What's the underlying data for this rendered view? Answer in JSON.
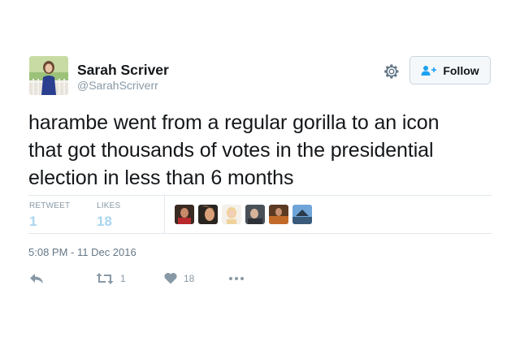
{
  "user": {
    "name": "Sarah Scriver",
    "handle": "@SarahScriverr"
  },
  "follow_label": "Follow",
  "tweet": {
    "line1": "harambe went from a regular gorilla to an icon",
    "line2": "that got thousands of votes in the presidential",
    "line3": "election in less than 6 months"
  },
  "stats": {
    "retweet_label": "RETWEET",
    "retweet_count": "1",
    "likes_label": "LIKES",
    "likes_count": "18"
  },
  "timestamp": "5:08 PM - 11 Dec 2016",
  "actions": {
    "retweet_count": "1",
    "like_count": "18"
  },
  "colors": {
    "stat_value": "#a8d6f0",
    "muted": "#8899a6",
    "follow_icon": "#1da1f2"
  },
  "icons": [
    "gear-icon",
    "follow-person-plus-icon",
    "reply-icon",
    "retweet-icon",
    "heart-icon",
    "more-icon"
  ]
}
